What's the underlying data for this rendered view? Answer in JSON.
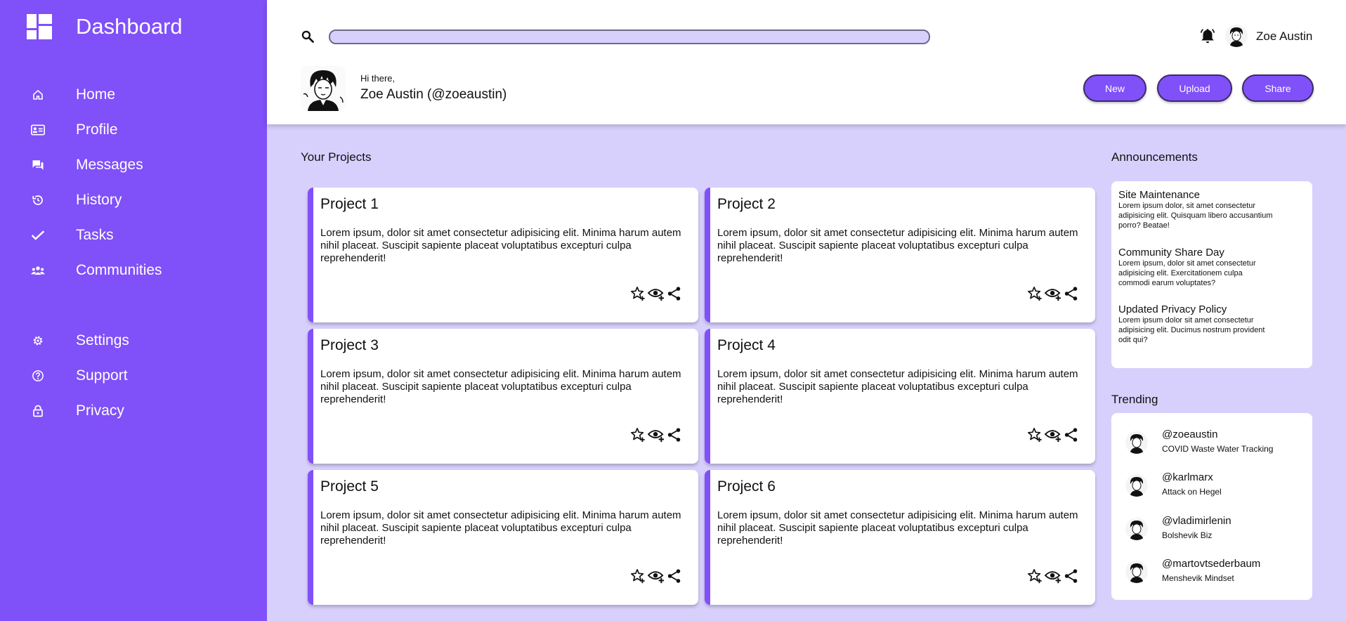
{
  "brand": {
    "title": "Dashboard"
  },
  "sidebar": {
    "items": [
      {
        "label": "Home",
        "icon": "home-icon"
      },
      {
        "label": "Profile",
        "icon": "id-card-icon"
      },
      {
        "label": "Messages",
        "icon": "chat-icon"
      },
      {
        "label": "History",
        "icon": "history-icon"
      },
      {
        "label": "Tasks",
        "icon": "check-icon"
      },
      {
        "label": "Communities",
        "icon": "group-icon"
      },
      {
        "label": "Settings",
        "icon": "gear-icon"
      },
      {
        "label": "Support",
        "icon": "help-icon"
      },
      {
        "label": "Privacy",
        "icon": "lock-icon"
      }
    ]
  },
  "header": {
    "search": {
      "value": "",
      "placeholder": ""
    },
    "user_name": "Zoe Austin",
    "greeting": "Hi there,",
    "greeting_name": "Zoe Austin (@zoeaustin)",
    "buttons": {
      "new": "New",
      "upload": "Upload",
      "share": "Share"
    }
  },
  "projects": {
    "title": "Your Projects",
    "items": [
      {
        "title": "Project 1",
        "description": "Lorem ipsum, dolor sit amet consectetur adipisicing elit. Minima harum autem nihil placeat. Suscipit sapiente placeat voluptatibus excepturi culpa reprehenderit!"
      },
      {
        "title": "Project 2",
        "description": "Lorem ipsum, dolor sit amet consectetur adipisicing elit. Minima harum autem nihil placeat. Suscipit sapiente placeat voluptatibus excepturi culpa reprehenderit!"
      },
      {
        "title": "Project 3",
        "description": "Lorem ipsum, dolor sit amet consectetur adipisicing elit. Minima harum autem nihil placeat. Suscipit sapiente placeat voluptatibus excepturi culpa reprehenderit!"
      },
      {
        "title": "Project 4",
        "description": "Lorem ipsum, dolor sit amet consectetur adipisicing elit. Minima harum autem nihil placeat. Suscipit sapiente placeat voluptatibus excepturi culpa reprehenderit!"
      },
      {
        "title": "Project 5",
        "description": "Lorem ipsum, dolor sit amet consectetur adipisicing elit. Minima harum autem nihil placeat. Suscipit sapiente placeat voluptatibus excepturi culpa reprehenderit!"
      },
      {
        "title": "Project 6",
        "description": "Lorem ipsum, dolor sit amet consectetur adipisicing elit. Minima harum autem nihil placeat. Suscipit sapiente placeat voluptatibus excepturi culpa reprehenderit!"
      }
    ],
    "action_icons": [
      "star-add-icon",
      "watch-add-icon",
      "share-icon"
    ]
  },
  "announcements": {
    "title": "Announcements",
    "items": [
      {
        "title": "Site Maintenance",
        "body": "Lorem ipsum dolor, sit amet consectetur adipisicing elit. Quisquam libero accusantium porro? Beatae!"
      },
      {
        "title": "Community Share Day",
        "body": "Lorem ipsum, dolor sit amet consectetur adipisicing elit. Exercitationem culpa commodi earum voluptates?"
      },
      {
        "title": "Updated Privacy Policy",
        "body": "Lorem ipsum dolor sit amet consectetur adipisicing elit. Ducimus nostrum provident odit qui?"
      }
    ]
  },
  "trending": {
    "title": "Trending",
    "items": [
      {
        "handle": "@zoeaustin",
        "topic": "COVID Waste Water Tracking"
      },
      {
        "handle": "@karlmarx",
        "topic": "Attack on Hegel"
      },
      {
        "handle": "@vladimirlenin",
        "topic": "Bolshevik Biz"
      },
      {
        "handle": "@martovtsederbaum",
        "topic": "Menshevik Mindset"
      }
    ]
  },
  "colors": {
    "accent": "#8050f8",
    "background": "#d8d0fc",
    "panel": "#ffffff"
  }
}
